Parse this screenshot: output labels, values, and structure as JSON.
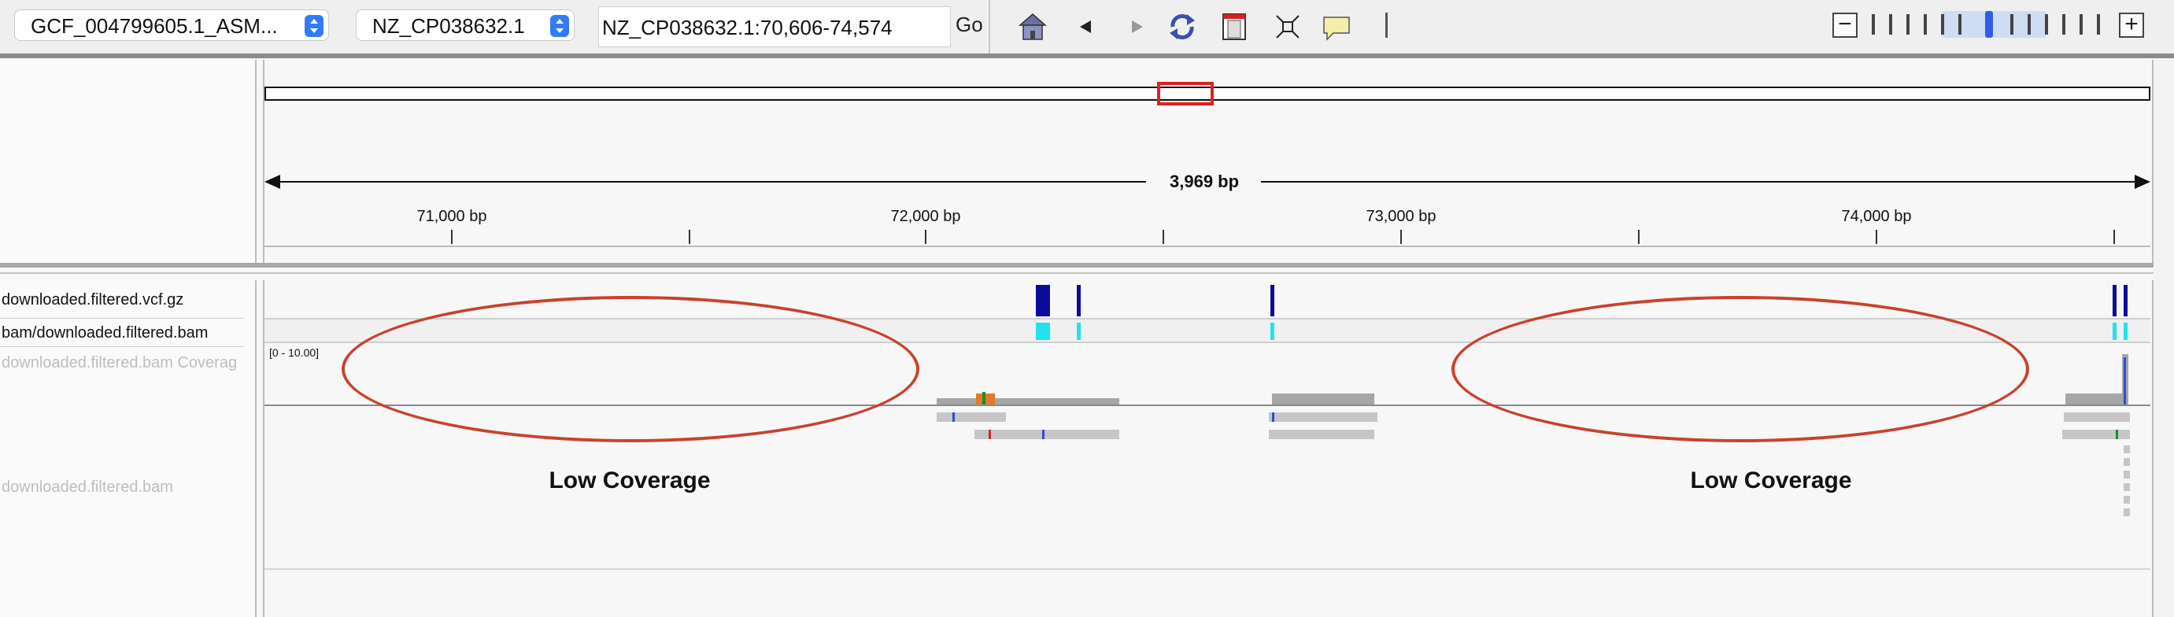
{
  "toolbar": {
    "genome": "GCF_004799605.1_ASM...",
    "chromosome": "NZ_CP038632.1",
    "locus": "NZ_CP038632.1:70,606-74,574",
    "go_label": "Go"
  },
  "ruler": {
    "span_label": "3,969 bp",
    "ticks": [
      "71,000 bp",
      "72,000 bp",
      "73,000 bp",
      "74,000 bp"
    ]
  },
  "tracks": {
    "vcf": "downloaded.filtered.vcf.gz",
    "bam_genotype": "bam/downloaded.filtered.bam",
    "coverage": "downloaded.filtered.bam Coverag",
    "alignment": "downloaded.filtered.bam",
    "coverage_range": "[0 - 10.00]"
  },
  "annotations": {
    "left": "Low Coverage",
    "right": "Low Coverage"
  },
  "colors": {
    "variant_dark": "#0c0c9c",
    "variant_cyan": "#1fe3f0",
    "annotation_red": "#c9422d",
    "region_box": "#e02020",
    "read_gray": "#c6c6c6"
  }
}
